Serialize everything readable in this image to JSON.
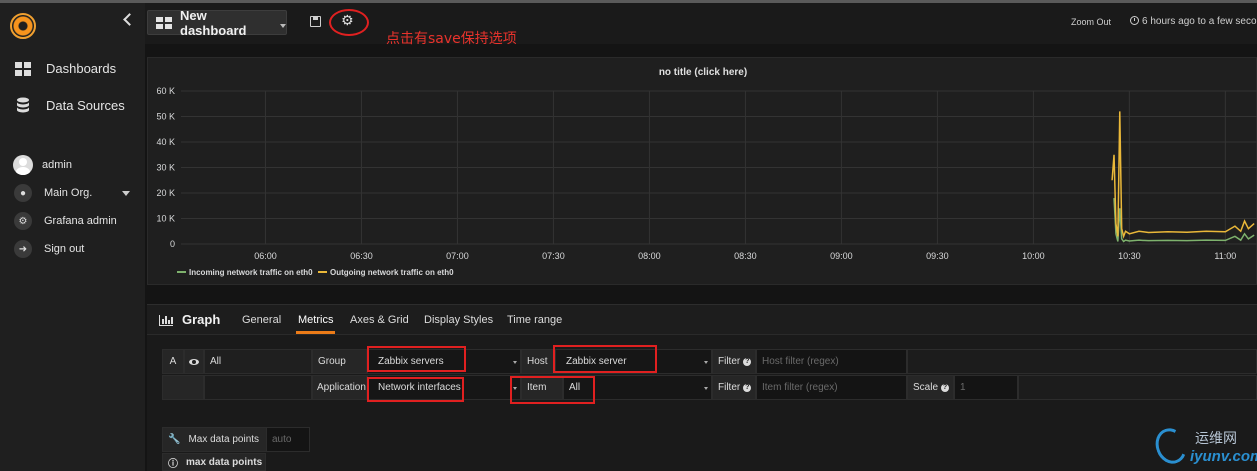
{
  "sidebar": {
    "items": [
      {
        "label": "Dashboards",
        "icon": "dashboards-icon"
      },
      {
        "label": "Data Sources",
        "icon": "database-icon"
      }
    ],
    "user": {
      "name": "admin",
      "org": "Main Org.",
      "grafana_admin": "Grafana admin",
      "sign_out": "Sign out"
    }
  },
  "topbar": {
    "dashboard_title": "New dashboard",
    "annotation": "点击有save保持选项",
    "zoom_out": "Zoom Out",
    "time_range": "6 hours ago to a few seco"
  },
  "panel": {
    "title": "no title (click here)"
  },
  "chart_data": {
    "type": "line",
    "title": "no title (click here)",
    "y_ticks": [
      "60 K",
      "50 K",
      "40 K",
      "30 K",
      "20 K",
      "10 K",
      "0"
    ],
    "x_ticks": [
      "06:00",
      "06:30",
      "07:00",
      "07:30",
      "08:00",
      "08:30",
      "09:00",
      "09:30",
      "10:00",
      "10:30",
      "11:00"
    ],
    "ylim": [
      0,
      60000
    ],
    "xlim_hours": [
      5.56,
      11.17
    ],
    "grid": true,
    "legend_position": "bottom-left",
    "series": [
      {
        "name": "Incoming network traffic on eth0",
        "color": "#7eb26d",
        "x_hours": [
          10.42,
          10.43,
          10.44,
          10.45,
          10.46,
          10.47,
          10.48,
          10.5,
          10.55,
          10.6,
          10.7,
          10.8,
          10.9,
          11.0,
          11.05,
          11.08,
          11.1,
          11.12,
          11.15
        ],
        "values": [
          18000,
          4000,
          1000,
          14000,
          2000,
          1000,
          1500,
          1200,
          1500,
          1300,
          1400,
          1300,
          1500,
          1400,
          3000,
          1500,
          4000,
          2000,
          3500
        ]
      },
      {
        "name": "Outgoing network traffic on eth0",
        "color": "#eab839",
        "x_hours": [
          10.41,
          10.42,
          10.43,
          10.44,
          10.45,
          10.46,
          10.47,
          10.48,
          10.5,
          10.55,
          10.6,
          10.7,
          10.8,
          10.9,
          11.0,
          11.05,
          11.08,
          11.1,
          11.12,
          11.15
        ],
        "values": [
          25000,
          35000,
          8000,
          3000,
          52000,
          6000,
          3000,
          5000,
          4000,
          5000,
          4500,
          4800,
          4600,
          5000,
          4800,
          7000,
          5000,
          9000,
          6000,
          8000
        ]
      }
    ]
  },
  "editor": {
    "panel_type": "Graph",
    "tabs": [
      "General",
      "Metrics",
      "Axes & Grid",
      "Display Styles",
      "Time range"
    ],
    "active_tab": "Metrics",
    "query": {
      "ref": "A",
      "all_label": "All",
      "group_label": "Group",
      "group_value": "Zabbix servers",
      "host_label": "Host",
      "host_value": "Zabbix server",
      "filter_label": "Filter",
      "host_filter_placeholder": "Host filter (regex)",
      "application_label": "Application",
      "application_value": "Network interfaces",
      "item_label": "Item",
      "item_value": "All",
      "item_filter_placeholder": "Item filter (regex)",
      "scale_label": "Scale",
      "scale_value": "1"
    },
    "max_data_points_label": "Max data points",
    "max_data_points_placeholder": "auto",
    "max_data_points_info": "max data points"
  },
  "watermark": {
    "cn": "运维网",
    "en": "iyunv.com"
  }
}
